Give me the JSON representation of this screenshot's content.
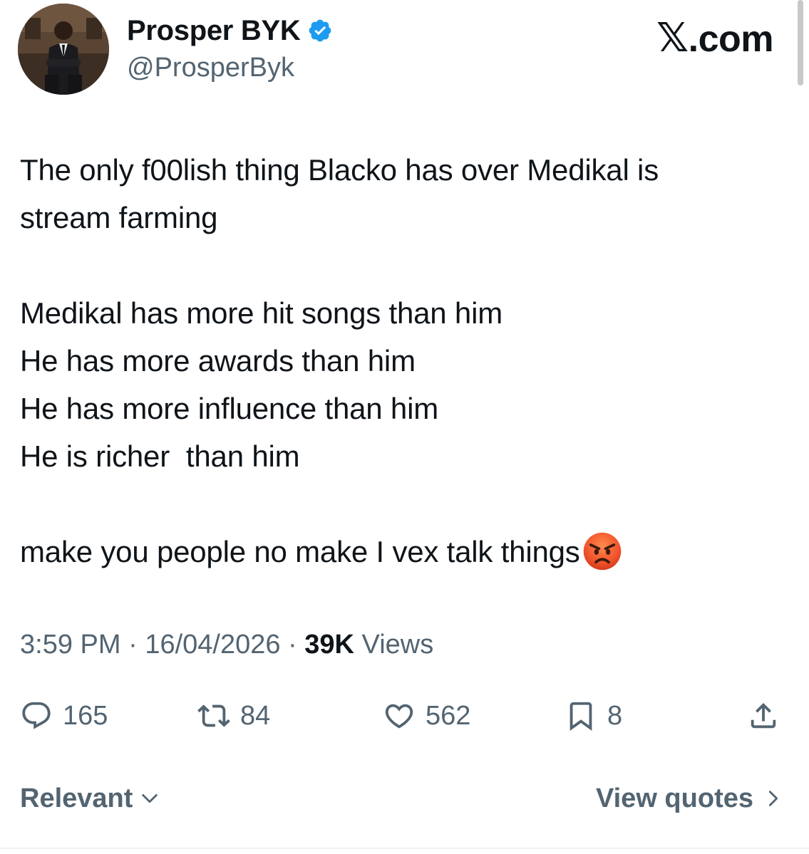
{
  "author": {
    "display_name": "Prosper BYK",
    "handle": "@ProsperByk",
    "verified": true
  },
  "brand": {
    "label": ".com",
    "x_glyph": "𝕏"
  },
  "tweet": {
    "lines": [
      "The only f00lish thing Blacko has over Medikal is",
      "stream farming",
      "",
      "Medikal has more hit songs than him",
      "He has more awards than him",
      "He has more influence than him",
      "He is richer  than him",
      "",
      "make you people no make I vex talk things"
    ],
    "emoji": "angry-face"
  },
  "meta": {
    "time": "3:59 PM",
    "sep1": " · ",
    "date": "16/04/2026",
    "sep2": " · ",
    "views_count": "39K",
    "views_label": " Views"
  },
  "actions": {
    "replies": "165",
    "reposts": "84",
    "likes": "562",
    "bookmarks": "8"
  },
  "footer": {
    "sort_label": "Relevant",
    "quotes_label": "View quotes"
  },
  "colors": {
    "text": "#0f1419",
    "muted": "#536471",
    "verified_blue": "#1d9bf0"
  }
}
